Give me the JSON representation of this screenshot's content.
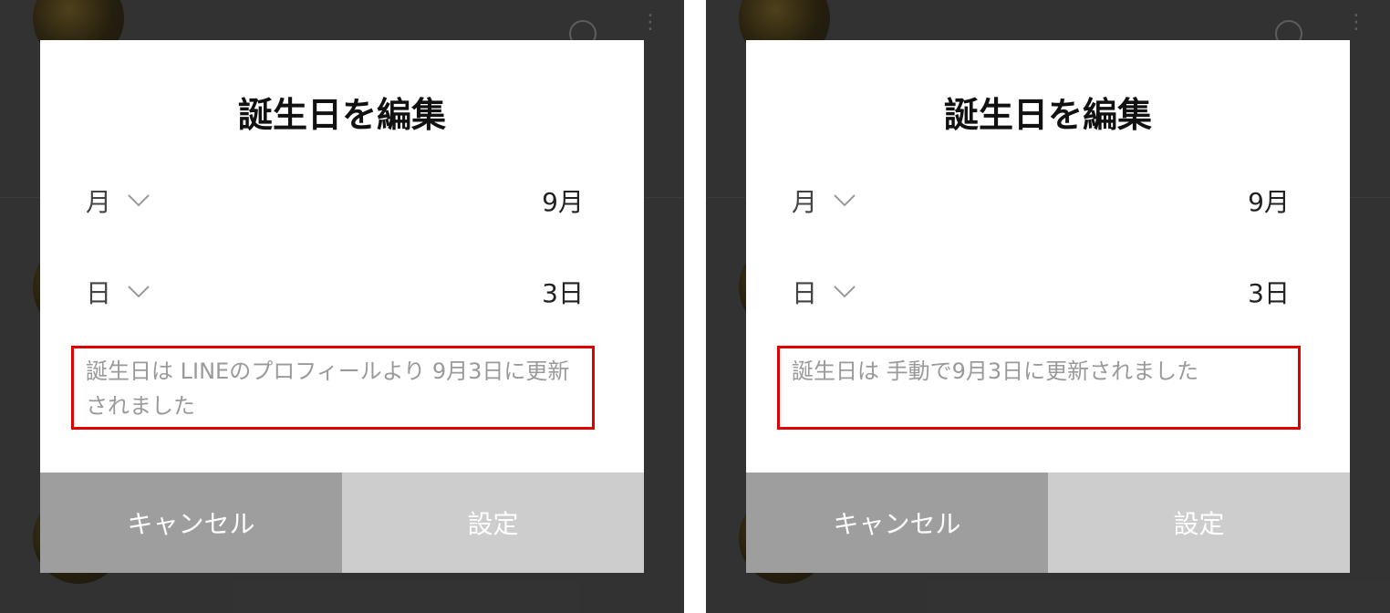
{
  "panels": [
    {
      "dialog_title": "誕生日を編集",
      "month_label": "月",
      "month_value": "9月",
      "day_label": "日",
      "day_value": "3日",
      "status_text": "誕生日は LINEのプロフィールより 9月3日に更新されました",
      "cancel_label": "キャンセル",
      "set_label": "設定"
    },
    {
      "dialog_title": "誕生日を編集",
      "month_label": "月",
      "month_value": "9月",
      "day_label": "日",
      "day_value": "3日",
      "status_text": "誕生日は 手動で9月3日に更新されました",
      "cancel_label": "キャンセル",
      "set_label": "設定"
    }
  ],
  "icons": {
    "dropdown": "chevron-down-icon"
  },
  "colors": {
    "highlight": "#e00000",
    "cancel_button": "#9e9e9e",
    "set_button": "#cdcdcd",
    "status_text": "#9a9a9a"
  }
}
